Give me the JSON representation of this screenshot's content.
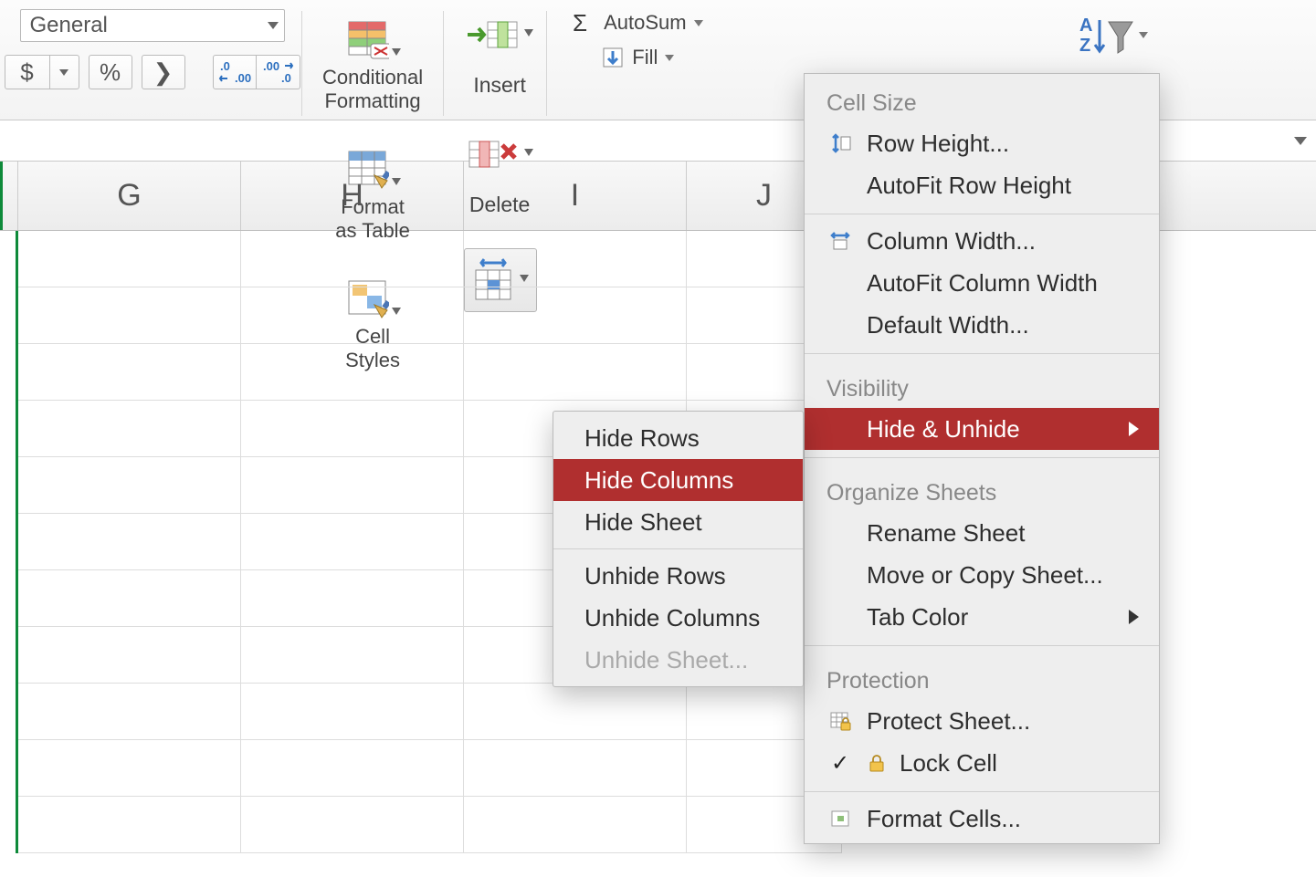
{
  "ribbon": {
    "number_format": "General",
    "currency_symbol": "$",
    "percent_symbol": "%",
    "comma_symbol": "❯",
    "conditional_formatting": "Conditional\nFormatting",
    "format_as_table": "Format\nas Table",
    "cell_styles": "Cell\nStyles",
    "insert": "Insert",
    "delete": "Delete",
    "autosum": "AutoSum",
    "fill": "Fill"
  },
  "columns": [
    "G",
    "H",
    "I",
    "J"
  ],
  "format_menu": {
    "cell_size_title": "Cell Size",
    "row_height": "Row Height...",
    "autofit_row_height": "AutoFit Row Height",
    "column_width": "Column Width...",
    "autofit_column_width": "AutoFit Column Width",
    "default_width": "Default Width...",
    "visibility_title": "Visibility",
    "hide_unhide": "Hide & Unhide",
    "organize_title": "Organize Sheets",
    "rename_sheet": "Rename Sheet",
    "move_copy_sheet": "Move or Copy Sheet...",
    "tab_color": "Tab Color",
    "protection_title": "Protection",
    "protect_sheet": "Protect Sheet...",
    "lock_cell": "Lock Cell",
    "format_cells": "Format Cells..."
  },
  "hide_submenu": {
    "hide_rows": "Hide Rows",
    "hide_columns": "Hide Columns",
    "hide_sheet": "Hide Sheet",
    "unhide_rows": "Unhide Rows",
    "unhide_columns": "Unhide Columns",
    "unhide_sheet": "Unhide Sheet..."
  }
}
